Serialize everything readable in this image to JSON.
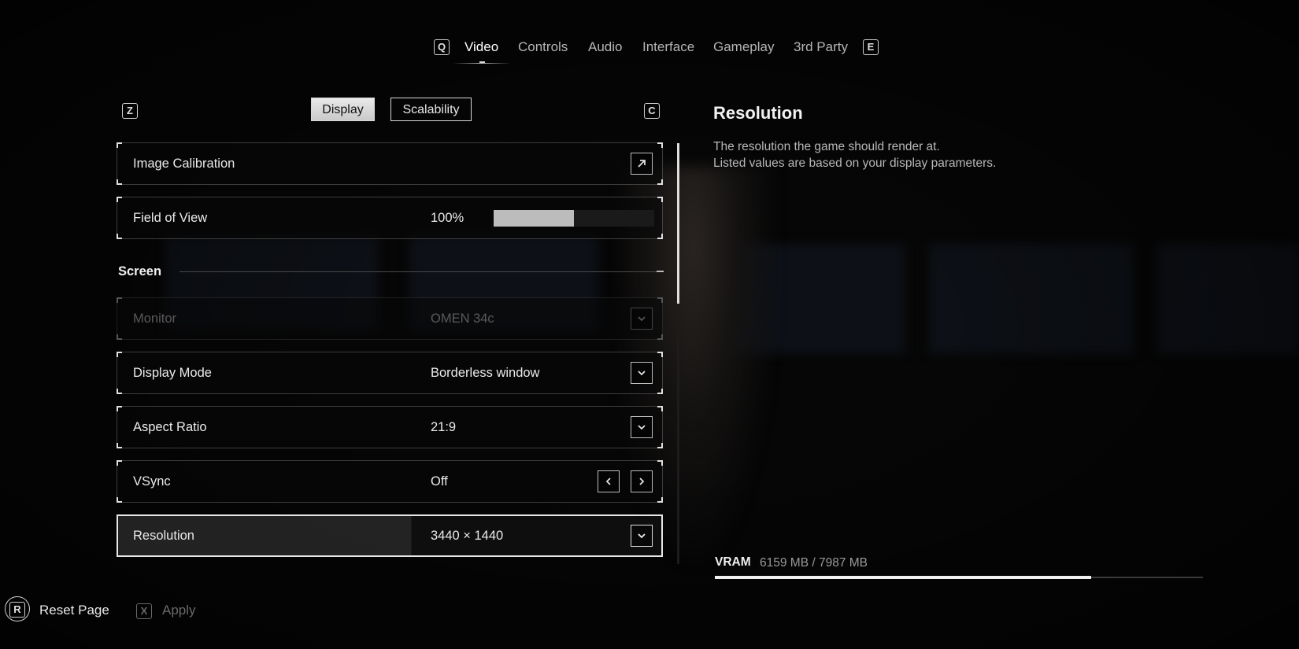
{
  "topnav": {
    "prev_key": "Q",
    "next_key": "E",
    "tabs": [
      {
        "label": "Video",
        "active": true
      },
      {
        "label": "Controls",
        "active": false
      },
      {
        "label": "Audio",
        "active": false
      },
      {
        "label": "Interface",
        "active": false
      },
      {
        "label": "Gameplay",
        "active": false
      },
      {
        "label": "3rd Party",
        "active": false
      }
    ]
  },
  "subnav": {
    "prev_key": "Z",
    "next_key": "C",
    "tabs": [
      {
        "label": "Display",
        "active": true
      },
      {
        "label": "Scalability",
        "active": false
      }
    ]
  },
  "settings": {
    "image_calibration": {
      "label": "Image Calibration",
      "icon": "arrow-up-right-icon"
    },
    "field_of_view": {
      "label": "Field of View",
      "value": "100%",
      "slider_fraction": 0.5
    },
    "screen_section": "Screen",
    "monitor": {
      "label": "Monitor",
      "value": "OMEN 34c",
      "disabled": true
    },
    "display_mode": {
      "label": "Display Mode",
      "value": "Borderless window"
    },
    "aspect_ratio": {
      "label": "Aspect Ratio",
      "value": "21:9"
    },
    "vsync": {
      "label": "VSync",
      "value": "Off"
    },
    "resolution": {
      "label": "Resolution",
      "value": "3440 × 1440",
      "selected": true
    }
  },
  "info_panel": {
    "title": "Resolution",
    "line1": "The resolution the game should render at.",
    "line2": "Listed values are based on your display parameters."
  },
  "vram": {
    "label": "VRAM",
    "value": "6159 MB / 7987 MB",
    "used_fraction": 0.771
  },
  "footer": {
    "reset_key": "R",
    "reset_label": "Reset Page",
    "apply_key": "X",
    "apply_label": "Apply"
  },
  "colors": {
    "background": "#060606",
    "text": "#e8e8e8",
    "muted": "#5a5a5a"
  }
}
